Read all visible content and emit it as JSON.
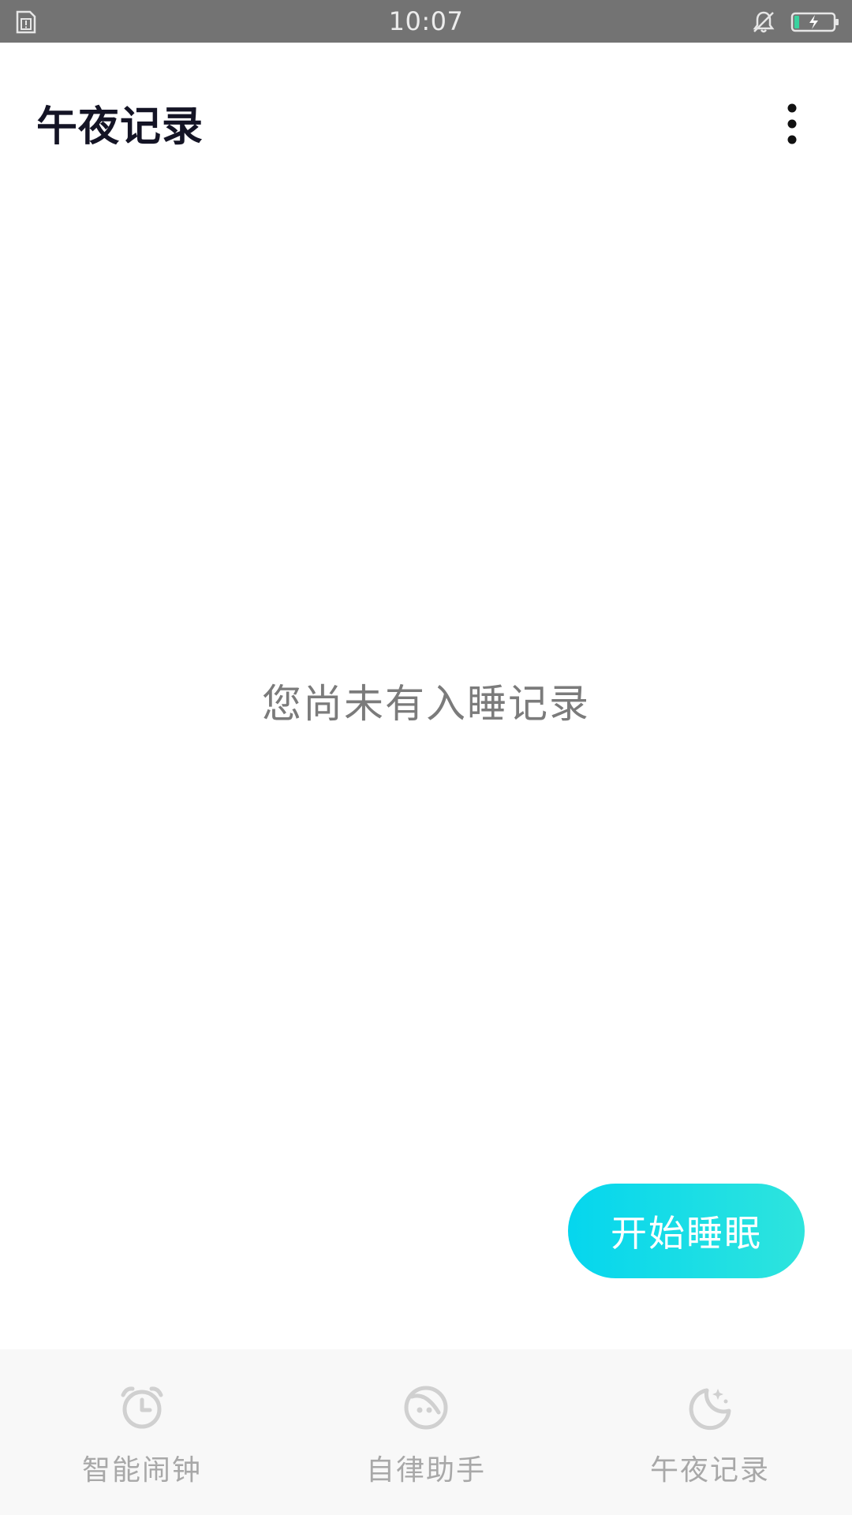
{
  "status_bar": {
    "time": "10:07",
    "left_icon": "sim-card-alert-icon",
    "bell_icon": "bell-muted-icon",
    "battery_icon": "battery-charging-icon"
  },
  "header": {
    "title": "午夜记录",
    "more_icon": "more-vertical-icon"
  },
  "main": {
    "empty_message": "您尚未有入睡记录",
    "start_button_label": "开始睡眠"
  },
  "bottom_nav": {
    "items": [
      {
        "label": "智能闹钟",
        "icon": "alarm-clock-icon"
      },
      {
        "label": "自律助手",
        "icon": "assistant-face-icon"
      },
      {
        "label": "午夜记录",
        "icon": "moon-stars-icon"
      }
    ]
  },
  "colors": {
    "status_bar_bg": "#737373",
    "accent_gradient_start": "#05d6ee",
    "accent_gradient_end": "#2ee4dd",
    "nav_bg": "#f8f8f8",
    "nav_text": "#a8a8a8"
  }
}
